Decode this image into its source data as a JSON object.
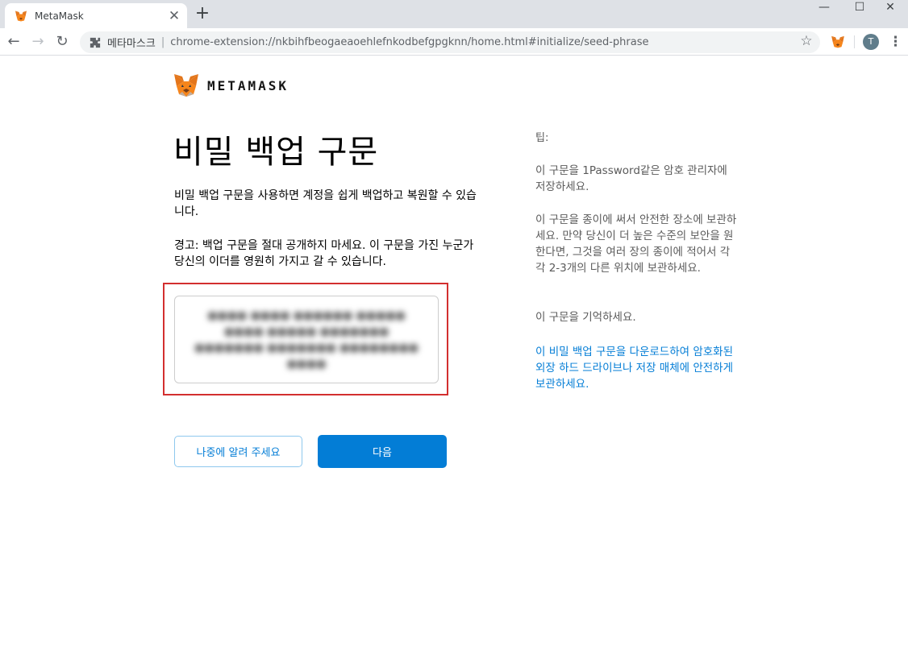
{
  "browser": {
    "tab_title": "MetaMask",
    "tab_close": "✕",
    "new_tab": "+",
    "win_min": "—",
    "win_max": "☐",
    "win_close": "✕",
    "back": "←",
    "forward": "→",
    "reload": "↻",
    "site_name": "메타마스크",
    "separator": "|",
    "url": "chrome-extension://nkbihfbeogaeaoehlefnkodbefgpgknn/home.html#initialize/seed-phrase",
    "star": "☆",
    "avatar_letter": "T",
    "menu": "⋮",
    "icons": [
      "puzzle-icon",
      "metamask-fox-icon",
      "star-icon",
      "kebab-menu-icon"
    ]
  },
  "brand": {
    "wordmark": "METAMASK",
    "fox_colors": [
      "#e2761b",
      "#e4761b",
      "#f6851b",
      "#763d16",
      "#c0ad9e"
    ]
  },
  "main": {
    "title": "비밀 백업 구문",
    "description": "비밀 백업 구문을 사용하면 계정을 쉽게 백업하고 복원할 수 있습니다.",
    "warning": "경고: 백업 구문을 절대 공개하지 마세요. 이 구문을 가진 누군가 당신의 이더를 영원히 가지고 갈 수 있습니다.",
    "seed_placeholder": "●●●● ●●●● ●●●●●● ●●●●● ●●●● ●●●●● ●●●●●●● ●●●●●●● ●●●●●●● ●●●●●●●● ●●●●"
  },
  "buttons": {
    "remind_later": "나중에 알려 주세요",
    "next": "다음"
  },
  "tips": {
    "title": "팁:",
    "tip1": "이 구문을 1Password같은 암호 관리자에 저장하세요.",
    "tip2": "이 구문을 종이에 써서 안전한 장소에 보관하세요. 만약 당신이 더 높은 수준의 보안을 원한다면, 그것을 여러 장의 종이에 적어서 각각 2-3개의 다른 위치에 보관하세요.",
    "tip3": "이 구문을 기억하세요.",
    "download_link": "이 비밀 백업 구문을 다운로드하여 암호화된 외장 하드 드라이브나 저장 매체에 안전하게 보관하세요."
  },
  "colors": {
    "accent": "#037dd6",
    "highlight_border": "#d32f2f",
    "tip_text": "#5a5a5a"
  }
}
